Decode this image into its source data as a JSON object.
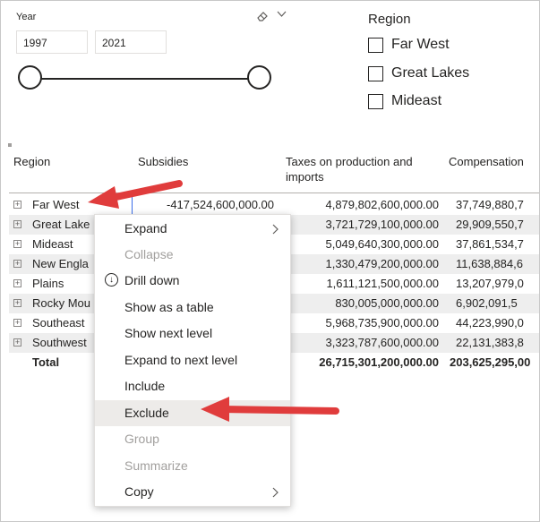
{
  "year_slicer": {
    "title": "Year",
    "start": "1997",
    "end": "2021",
    "eraser_icon": "eraser-icon",
    "menu_icon": "chevron-down-icon"
  },
  "region_slicer": {
    "title": "Region",
    "options": [
      "Far West",
      "Great Lakes",
      "Mideast"
    ]
  },
  "matrix": {
    "headers": {
      "region": "Region",
      "subsidies": "Subsidies",
      "taxes_line1": "Taxes on production and",
      "taxes_line2": "imports",
      "compensation": "Compensation"
    },
    "rows": [
      {
        "region": "Far West",
        "subsidies": "-417,524,600,000.00",
        "taxes": "4,879,802,600,000.00",
        "compensation": "37,749,880,7"
      },
      {
        "region": "Great Lake",
        "subsidies": "",
        "taxes": "3,721,729,100,000.00",
        "compensation": "29,909,550,7"
      },
      {
        "region": "Mideast",
        "subsidies": "",
        "taxes": "5,049,640,300,000.00",
        "compensation": "37,861,534,7"
      },
      {
        "region": "New Engla",
        "subsidies": "",
        "taxes": "1,330,479,200,000.00",
        "compensation": "11,638,884,6"
      },
      {
        "region": "Plains",
        "subsidies": "",
        "taxes": "1,611,121,500,000.00",
        "compensation": "13,207,979,0"
      },
      {
        "region": "Rocky Mou",
        "subsidies": "",
        "taxes": "830,005,000,000.00",
        "compensation": "6,902,091,5"
      },
      {
        "region": "Southeast",
        "subsidies": "",
        "taxes": "5,968,735,900,000.00",
        "compensation": "44,223,990,0"
      },
      {
        "region": "Southwest",
        "subsidies": "",
        "taxes": "3,323,787,600,000.00",
        "compensation": "22,131,383,8"
      }
    ],
    "total": {
      "label": "Total",
      "taxes": "26,715,301,200,000.00",
      "compensation": "203,625,295,00"
    }
  },
  "context_menu": {
    "items": [
      {
        "label": "Expand",
        "submenu": true,
        "disabled": false
      },
      {
        "label": "Collapse",
        "submenu": false,
        "disabled": true
      },
      {
        "label": "Drill down",
        "submenu": false,
        "disabled": false,
        "icon": "drill-down-icon"
      },
      {
        "label": "Show as a table",
        "submenu": false,
        "disabled": false
      },
      {
        "label": "Show next level",
        "submenu": false,
        "disabled": false
      },
      {
        "label": "Expand to next level",
        "submenu": false,
        "disabled": false
      },
      {
        "label": "Include",
        "submenu": false,
        "disabled": false
      },
      {
        "label": "Exclude",
        "submenu": false,
        "disabled": false,
        "highlighted": true
      },
      {
        "label": "Group",
        "submenu": false,
        "disabled": true
      },
      {
        "label": "Summarize",
        "submenu": false,
        "disabled": true
      },
      {
        "label": "Copy",
        "submenu": true,
        "disabled": false
      }
    ]
  },
  "colors": {
    "arrow": "#e03c3c",
    "alt_row": "#eeeeee",
    "menu_highlight": "#edebe9",
    "disabled_text": "#a19f9d"
  }
}
